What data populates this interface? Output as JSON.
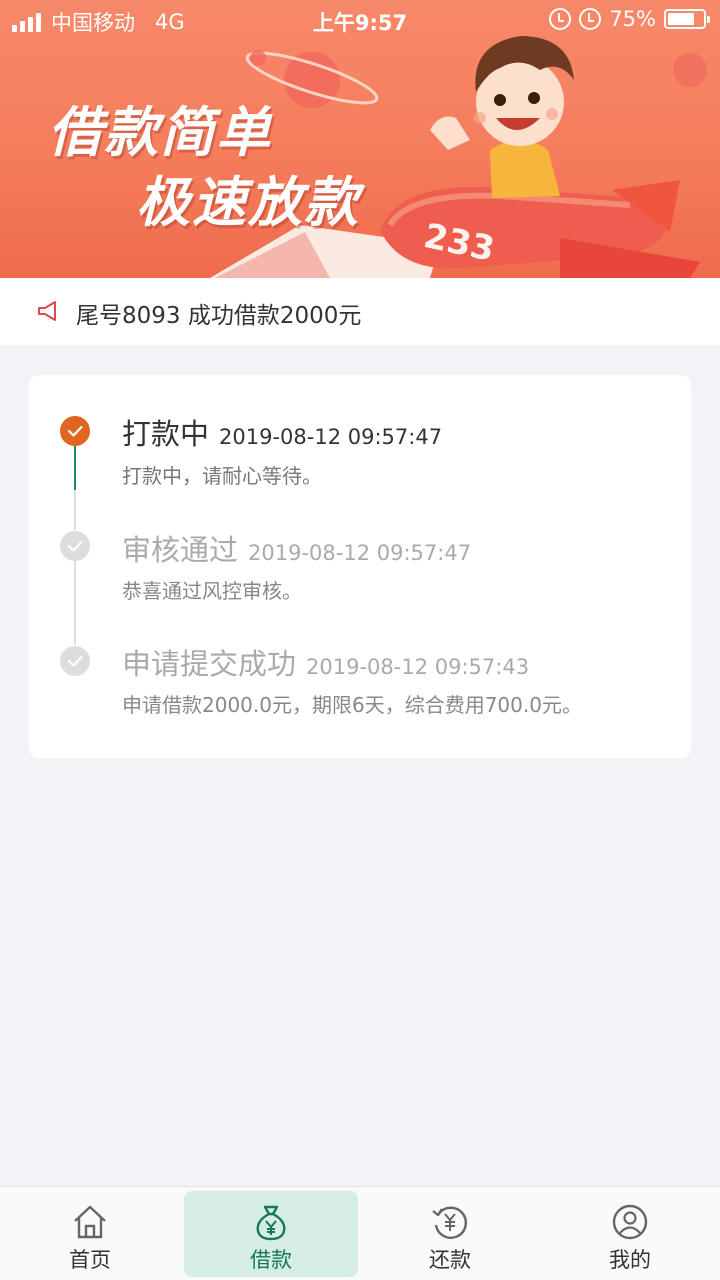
{
  "status_bar": {
    "carrier": "中国移动",
    "network": "4G",
    "time": "上午9:57",
    "battery": "75%",
    "battery_level": 0.75
  },
  "banner": {
    "line1": "借款简单",
    "line2": "极速放款",
    "plane_number": "233"
  },
  "notice": {
    "icon": "megaphone-icon",
    "text": "尾号8093 成功借款2000元"
  },
  "steps": [
    {
      "title": "打款中",
      "time": "2019-08-12 09:57:47",
      "desc": "打款中，请耐心等待。",
      "state": "active"
    },
    {
      "title": "审核通过",
      "time": "2019-08-12 09:57:47",
      "desc": "恭喜通过风控审核。",
      "state": "done"
    },
    {
      "title": "申请提交成功",
      "time": "2019-08-12 09:57:43",
      "desc": "申请借款2000.0元，期限6天，综合费用700.0元。",
      "state": "done"
    }
  ],
  "tabs": [
    {
      "label": "首页",
      "icon": "home-icon"
    },
    {
      "label": "借款",
      "icon": "money-bag-icon",
      "selected": true
    },
    {
      "label": "还款",
      "icon": "repay-icon"
    },
    {
      "label": "我的",
      "icon": "profile-icon"
    }
  ],
  "colors": {
    "accent": "#e0661f",
    "brand_green": "#14795a",
    "banner": "#f57d5c"
  }
}
